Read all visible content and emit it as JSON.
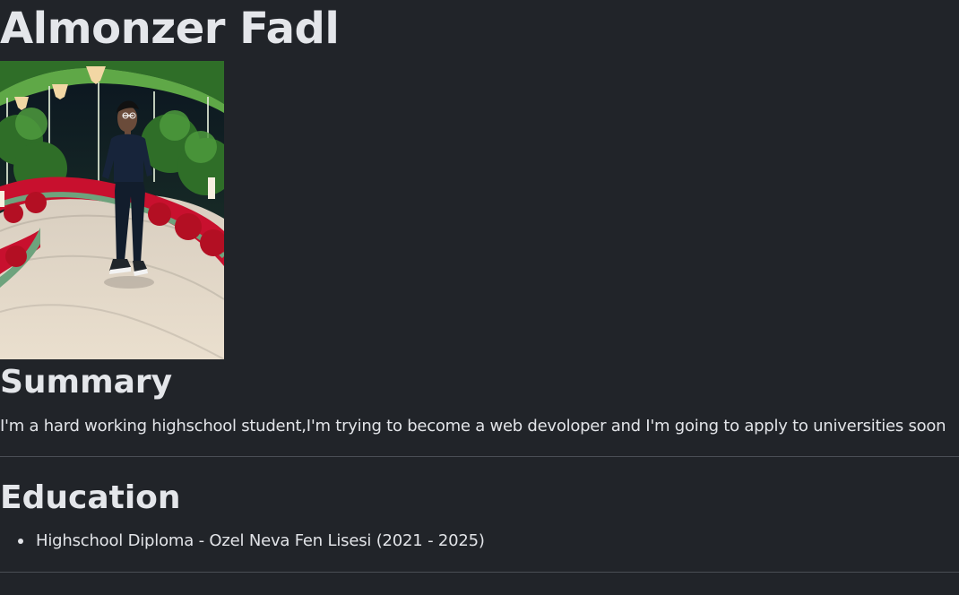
{
  "profile": {
    "name": "Almonzer Fadl"
  },
  "photo": {
    "icon": "profile-photo"
  },
  "summary": {
    "title": "Summary",
    "text": "I'm a hard working highschool student,I'm trying to become a web devoloper and I'm going to apply to universities soon"
  },
  "education": {
    "title": "Education",
    "items": [
      {
        "label": "Highschool Diploma - Ozel Neva Fen Lisesi (2021 - 2025)"
      }
    ]
  },
  "colors": {
    "background": "#212429",
    "text": "#e8e9ec",
    "divider": "#4a4e55"
  }
}
